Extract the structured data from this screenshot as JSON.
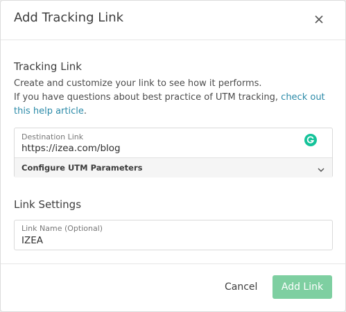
{
  "modal": {
    "title": "Add Tracking Link",
    "close_icon": "close-icon"
  },
  "tracking_section": {
    "heading": "Tracking Link",
    "line1": "Create and customize your link to see how it performs.",
    "line2_prefix": "If you have questions about best practice of UTM tracking, ",
    "help_link": "check out this help article",
    "line2_suffix": "."
  },
  "destination": {
    "label": "Destination Link",
    "value": "https://izea.com/blog",
    "utm_label": "Configure UTM Parameters",
    "expand_icon": "chevron-down-icon",
    "extension_icon": "grammarly-icon"
  },
  "settings_section": {
    "heading": "Link Settings",
    "name_label": "Link Name (Optional)",
    "name_value": "IZEA"
  },
  "footer": {
    "cancel_label": "Cancel",
    "add_label": "Add Link"
  },
  "colors": {
    "accent_link": "#2b8aa8",
    "primary_button": "#7ecfa1",
    "grammarly": "#15c39a"
  }
}
